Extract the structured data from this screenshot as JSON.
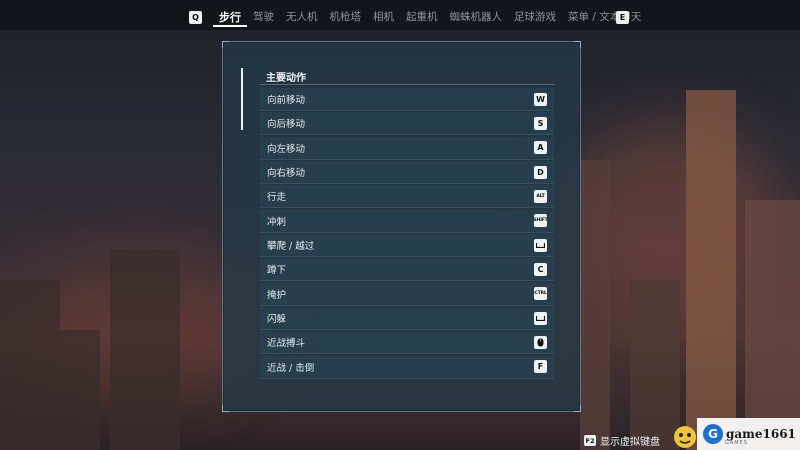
{
  "header": {
    "left_key": "Q",
    "right_key": "E",
    "tabs": [
      {
        "label": "步行",
        "active": true
      },
      {
        "label": "驾驶",
        "active": false
      },
      {
        "label": "无人机",
        "active": false
      },
      {
        "label": "机枪塔",
        "active": false
      },
      {
        "label": "相机",
        "active": false
      },
      {
        "label": "起重机",
        "active": false
      },
      {
        "label": "蜘蛛机器人",
        "active": false
      },
      {
        "label": "足球游戏",
        "active": false
      },
      {
        "label": "菜单 / 文本聊天",
        "active": false
      }
    ]
  },
  "panel": {
    "section_title": "主要动作",
    "actions": [
      {
        "label": "向前移动",
        "key": "W"
      },
      {
        "label": "向后移动",
        "key": "S"
      },
      {
        "label": "向左移动",
        "key": "A"
      },
      {
        "label": "向右移动",
        "key": "D"
      },
      {
        "label": "行走",
        "key": "ALT"
      },
      {
        "label": "冲刺",
        "key": "SHIFT"
      },
      {
        "label": "攀爬 / 越过",
        "key": "space-icon"
      },
      {
        "label": "蹲下",
        "key": "C"
      },
      {
        "label": "掩护",
        "key": "CTRL"
      },
      {
        "label": "闪躲",
        "key": "space-icon"
      },
      {
        "label": "近战搏斗",
        "key": "mouse-icon"
      },
      {
        "label": "近战 / 击倒",
        "key": "F"
      }
    ]
  },
  "footer": {
    "key": "F2",
    "label": "显示虚拟键盘"
  },
  "watermark": {
    "logo": "G",
    "text": "game1661",
    "subtext": "GAMES"
  }
}
